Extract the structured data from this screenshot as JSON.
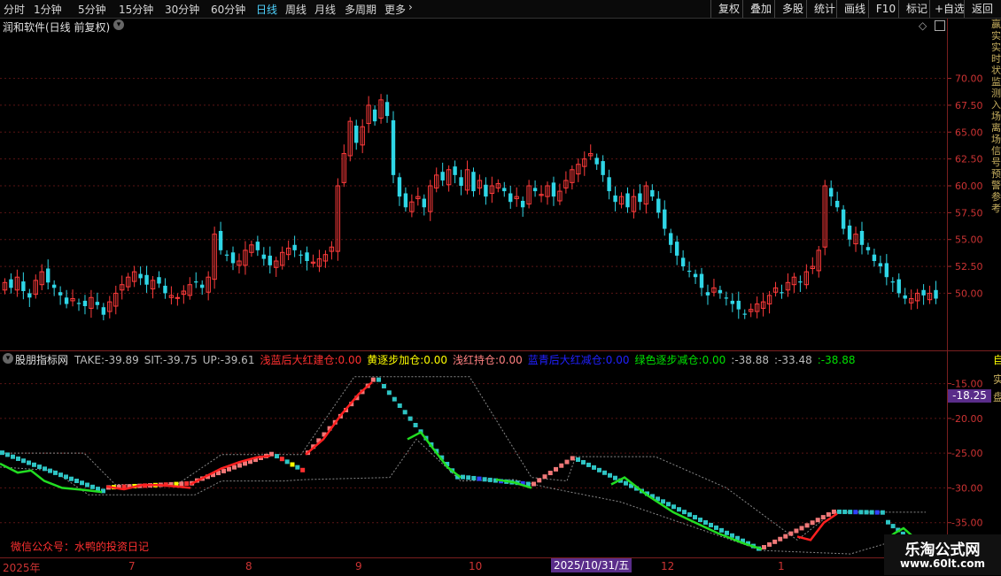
{
  "toolbar": {
    "timeframes": [
      "分时",
      "1分钟",
      "5分钟",
      "15分钟",
      "30分钟",
      "60分钟",
      "日线",
      "周线",
      "月线",
      "多周期",
      "更多"
    ],
    "active_timeframe": "日线",
    "right_buttons": [
      "复权",
      "叠加",
      "多股",
      "统计",
      "画线",
      "F10",
      "标记",
      "+自选",
      "返回"
    ]
  },
  "main_panel": {
    "title": "润和软件(日线 前复权)",
    "price_ticks": [
      "70.00",
      "67.50",
      "65.00",
      "62.50",
      "60.00",
      "57.50",
      "55.00",
      "52.50",
      "50.00"
    ]
  },
  "right_strip_text": "赢实实时状监测入场离场信号预警参考",
  "indicator_panel": {
    "name": "股朋指标网",
    "values": [
      {
        "label": "TAKE:",
        "value": "-39.89",
        "color": "#bbbbbb"
      },
      {
        "label": "SIT:",
        "value": "-39.75",
        "color": "#bbbbbb"
      },
      {
        "label": "UP:",
        "value": "-39.61",
        "color": "#bbbbbb"
      },
      {
        "label": "浅蓝后大红建仓:",
        "value": "0.00",
        "color": "#ff3030"
      },
      {
        "label": "黄逐步加仓:",
        "value": "0.00",
        "color": "#ffff00"
      },
      {
        "label": "浅红持仓:",
        "value": "0.00",
        "color": "#ff8080"
      },
      {
        "label": "蓝青后大红减仓:",
        "value": "0.00",
        "color": "#2020ff"
      },
      {
        "label": "绿色逐步减仓:",
        "value": "0.00",
        "color": "#00e000"
      },
      {
        "label": ":",
        "value": "-38.88",
        "color": "#bbbbbb"
      },
      {
        "label": ":",
        "value": "-33.48",
        "color": "#bbbbbb"
      },
      {
        "label": ":",
        "value": "-38.88",
        "color": "#00e000"
      }
    ],
    "axis_ticks": [
      "-15.00",
      "-20.00",
      "-25.00",
      "-30.00",
      "-35.00"
    ],
    "cursor_value": "-18.25",
    "right_labels": [
      "自",
      "实",
      "盘"
    ],
    "footer_text": "微信公众号：水鸭的投资日记"
  },
  "date_axis": {
    "labels": [
      "2025年",
      "7",
      "8",
      "9",
      "10",
      "12",
      "1"
    ],
    "cursor_date": "2025/10/31/五"
  },
  "watermark": {
    "title": "乐淘公式网",
    "url": "www.60lt.com"
  },
  "chart_data": [
    {
      "type": "candlestick",
      "title": "润和软件(日线 前复权)",
      "ylim": [
        46,
        74
      ],
      "close_approx": [
        51.0,
        50.5,
        51.5,
        50.2,
        49.6,
        51.2,
        52.0,
        51.0,
        50.5,
        49.8,
        49.0,
        49.5,
        49.0,
        48.8,
        49.6,
        48.9,
        48.0,
        49.2,
        50.0,
        50.8,
        51.5,
        52.0,
        51.4,
        50.8,
        51.2,
        50.9,
        50.0,
        49.8,
        49.6,
        50.2,
        50.8,
        51.0,
        50.5,
        51.5,
        55.5,
        54.0,
        53.5,
        52.8,
        53.0,
        54.0,
        54.5,
        54.0,
        53.2,
        52.6,
        53.0,
        53.8,
        54.2,
        54.0,
        53.5,
        53.0,
        52.9,
        53.2,
        53.6,
        54.3,
        60.0,
        63.0,
        66.0,
        64.0,
        65.5,
        67.5,
        66.0,
        68.0,
        66.5,
        61.0,
        59.0,
        58.0,
        58.5,
        59.0,
        58.0,
        60.0,
        61.0,
        60.5,
        61.5,
        61.0,
        60.0,
        61.5,
        59.5,
        60.5,
        59.0,
        60.0,
        60.2,
        59.5,
        58.5,
        59.0,
        58.0,
        60.0,
        59.5,
        59.2,
        60.0,
        59.0,
        59.5,
        60.5,
        61.5,
        62.0,
        62.5,
        63.0,
        62.0,
        61.0,
        59.5,
        58.5,
        59.0,
        58.0,
        59.0,
        58.5,
        60.0,
        59.0,
        57.5,
        56.0,
        54.5,
        53.5,
        52.5,
        52.0,
        51.5,
        50.5,
        49.8,
        50.5,
        50.0,
        49.5,
        49.0,
        48.5,
        48.0,
        48.5,
        49.0,
        49.2,
        49.8,
        50.5,
        50.0,
        51.0,
        51.5,
        51.0,
        52.0,
        52.5,
        54.0,
        60.0,
        59.0,
        58.0,
        56.0,
        55.0,
        55.5,
        54.5,
        54.0,
        53.0,
        52.5,
        51.5,
        51.0,
        50.0,
        49.5,
        49.5,
        50.0,
        49.8,
        50.0,
        49.5
      ]
    },
    {
      "type": "line",
      "ylim": [
        -40,
        -12
      ],
      "series": [
        {
          "name": "浅蓝后大红建仓",
          "color": "#ff2020",
          "values": [
            -25.8,
            -27.2,
            -28.5,
            -29.4,
            -30.2,
            -30.4,
            -30.6,
            -30.0,
            -29.5,
            -29.8,
            -30.0,
            -30.2,
            -29.6,
            -28.8,
            -27.5,
            -26.5,
            -25.9,
            -25.6,
            -25.4,
            -25.5,
            -27.2,
            -26.0,
            -23.5,
            -21.0,
            -18.5,
            -16.5,
            -15.0,
            -14.8
          ]
        },
        {
          "name": "绿色逐步减仓",
          "color": "#22dd22",
          "values": [
            -27.0,
            -28.5,
            -29.5,
            -30.0,
            -30.4,
            -28.3,
            -29.0,
            -29.3,
            -29.0,
            -25.8,
            -24.0,
            -22.0,
            -23.0,
            -25.5,
            -27.5,
            -28.4,
            -28.6,
            -29.2,
            -29.5,
            -29.9,
            -29.2,
            -30.5,
            -32.0,
            -33.5,
            -34.5,
            -35.0,
            -36.0,
            -37.5,
            -38.5,
            -39.0,
            -38.2,
            -36.5,
            -37.5,
            -38.8
          ]
        }
      ]
    }
  ]
}
